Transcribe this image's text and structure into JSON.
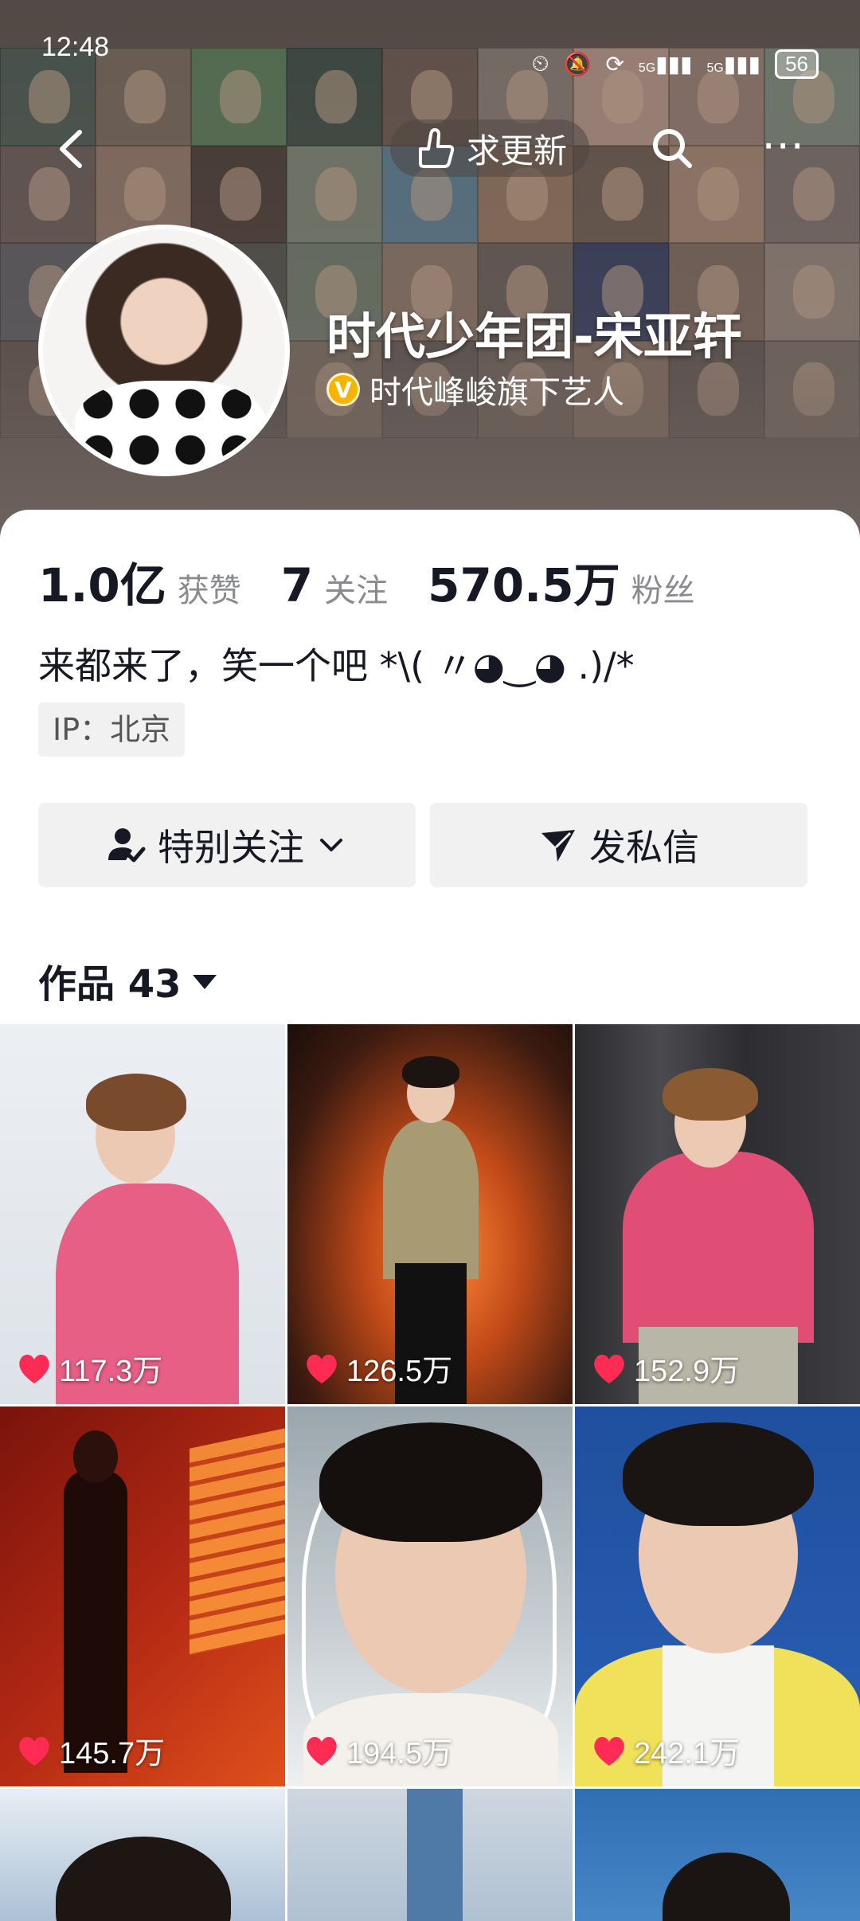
{
  "status_bar": {
    "time": "12:48",
    "network_label_1": "5G",
    "network_label_2": "5G",
    "battery": "56",
    "icons": [
      "alarm-icon",
      "mute-icon",
      "sync-icon",
      "signal-icon",
      "signal-icon",
      "battery-icon"
    ]
  },
  "topbar": {
    "update_label": "求更新"
  },
  "profile": {
    "name": "时代少年团-宋亚轩",
    "verified_badge": "V",
    "verified_text": "时代峰峻旗下艺人",
    "stats": [
      {
        "value": "1.0亿",
        "label": "获赞"
      },
      {
        "value": "7",
        "label": "关注"
      },
      {
        "value": "570.5万",
        "label": "粉丝"
      }
    ],
    "bio": "来都来了，笑一个吧 *\\( 〃◕‿◕ .)/*",
    "ip": "IP：北京"
  },
  "actions": {
    "follow_label": "特别关注",
    "message_label": "发私信"
  },
  "works_tab": {
    "label": "作品 43"
  },
  "videos": [
    {
      "likes": "117.3万"
    },
    {
      "likes": "126.5万"
    },
    {
      "likes": "152.9万"
    },
    {
      "likes": "145.7万"
    },
    {
      "likes": "194.5万"
    },
    {
      "likes": "242.1万"
    }
  ],
  "colors": {
    "heart": "#fe2c55",
    "verified": "#f6b300",
    "button_bg": "#f1f1f2",
    "text": "#161823",
    "muted": "#8a8b91"
  }
}
